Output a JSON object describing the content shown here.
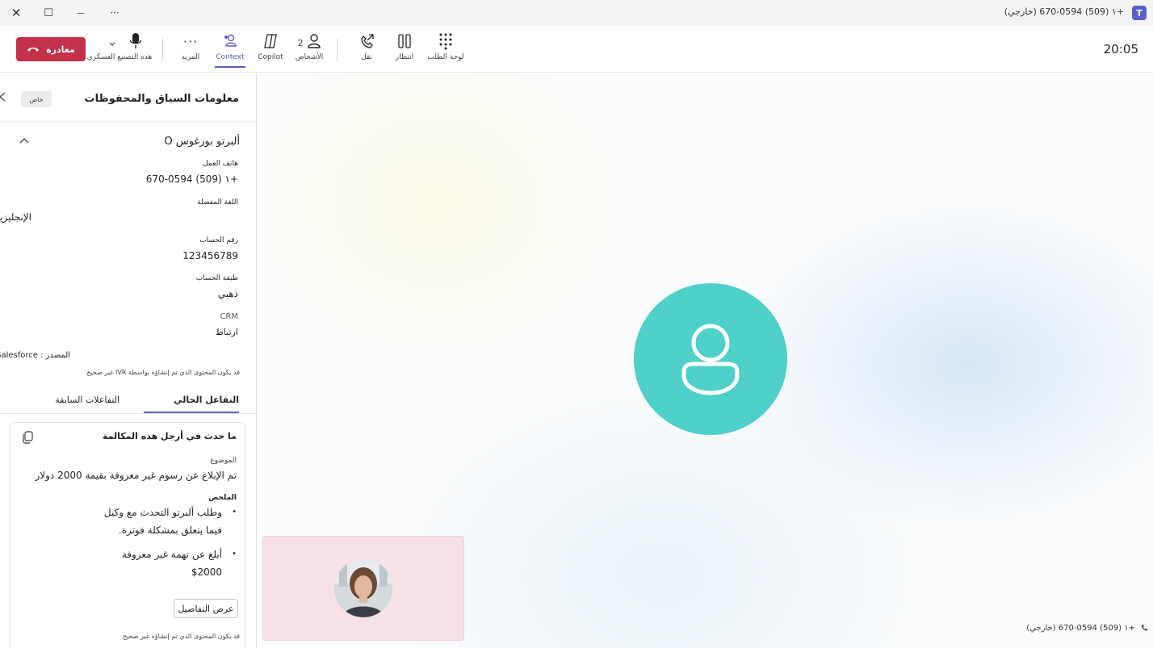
{
  "titlebar": {
    "title": "+١ (509) 670-0594 (خارجي)",
    "app_icon_letter": "T",
    "close_glyph": "✕",
    "maximize_glyph": "☐",
    "minimize_glyph": "—",
    "more_glyph": "···"
  },
  "toolbar": {
    "leave_label": "مغادرة",
    "mic_label": "هذه التصنيع العسكري",
    "more_label": "المزيد",
    "context_label": "Context",
    "copilot_label": "Copilot",
    "people_label": "الأشخاص",
    "people_count": "2",
    "transfer_label": "نقل",
    "hold_label": "انتظار",
    "dialpad_label": "لوحة الطلب",
    "timer": "20:05"
  },
  "panel": {
    "title": "معلومات السياق والمحفوظات",
    "private_label": "خاص",
    "contact_name": "ألبرتو بورغوس O",
    "fields": [
      {
        "label": "هاتف العمل",
        "value": "+١ (509) 670-0594"
      },
      {
        "label": "اللغة المفضلة",
        "value": "الإنجليزية"
      },
      {
        "label": "رقم الحساب",
        "value": "123456789"
      },
      {
        "label": "طبقة الحساب",
        "value": "ذهبي"
      }
    ],
    "crm_label": "CRM",
    "crm_value": "ارتباط",
    "source_value": "المصدر : Salesforce",
    "ivr_note": "قد يكون المحتوى الذي تم إنشاؤه بواسطة IVR غير صحيح",
    "tabs": {
      "current": "التفاعل الحالي",
      "previous": "التفاعلات السابقة"
    },
    "card": {
      "title": "ما حدث في أرجل هذه المكالمة",
      "subject_label": "الموضوع",
      "subject_value": "تم الإبلاغ عن رسوم غير معروفة بقيمة 2000 دولار",
      "summary_label": "الملخص",
      "bullets": [
        {
          "line1": "وطلب ألبرتو التحدث مع وكيل",
          "line2": "فيما يتعلق بمشكلة فوترة."
        },
        {
          "line1": "أبلغ عن تهمة غير معروفة",
          "line2": "$2000"
        }
      ],
      "details_button": "عرض التفاصيل"
    },
    "ai_note": "قد يكون المحتوى الذي تم إنشاؤه غير صحيح"
  },
  "stage": {
    "caption": "+١ (509) 670-0594 (خارجي)"
  },
  "colors": {
    "leave": "#c4314b",
    "accent": "#5b5fc7",
    "avatar": "#4fd0c9",
    "self_tile": "#f6e1e6"
  },
  "icons": {
    "mic": "microphone-icon",
    "leave": "phone-hangup-icon",
    "context": "context-person-icon",
    "copilot": "copilot-icon",
    "people": "people-icon",
    "transfer": "transfer-call-icon",
    "hold": "pause-icon",
    "dialpad": "dialpad-icon",
    "copy": "copy-icon"
  }
}
